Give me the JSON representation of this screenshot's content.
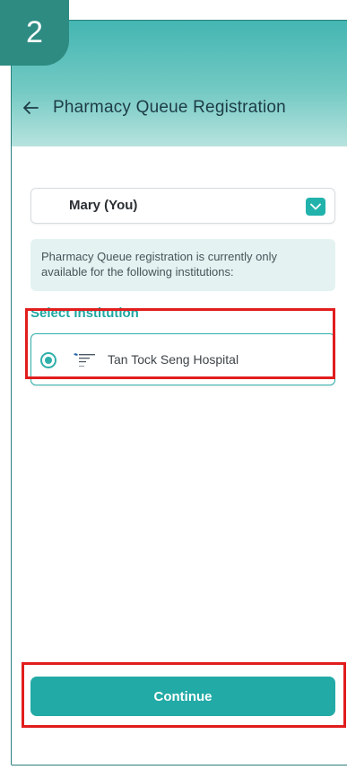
{
  "step": {
    "number": "2"
  },
  "header": {
    "title": "Pharmacy Queue Registration"
  },
  "patient_selector": {
    "selected": "Mary (You)"
  },
  "notice": {
    "text": "Pharmacy Queue registration is currently only available for the following institutions:"
  },
  "institution_section": {
    "label": "Select Institution",
    "options": [
      {
        "name": "Tan Tock Seng Hospital",
        "selected": true,
        "logo_icon": "tan-tock-seng-logo"
      }
    ]
  },
  "footer": {
    "continue_label": "Continue"
  },
  "colors": {
    "accent": "#22aaa6",
    "highlight": "#e11d1d",
    "badge": "#2d8b82"
  }
}
